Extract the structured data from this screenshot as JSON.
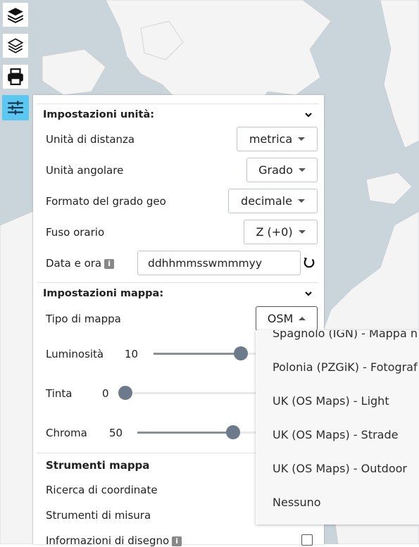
{
  "toolbar": {
    "items": [
      {
        "icon": "layers-icon",
        "active": false
      },
      {
        "icon": "layers-outline-icon",
        "active": false
      },
      {
        "icon": "print-icon",
        "active": false
      },
      {
        "icon": "sliders-icon",
        "active": true
      }
    ]
  },
  "unit_settings": {
    "title": "Impostazioni unità:",
    "distance": {
      "label": "Unità di distanza",
      "value": "metrica"
    },
    "angular": {
      "label": "Unità angolare",
      "value": "Grado"
    },
    "geo_format": {
      "label": "Formato del grado geo",
      "value": "decimale"
    },
    "timezone": {
      "label": "Fuso orario",
      "value": "Z (+0)"
    },
    "datetime": {
      "label": "Data e ora",
      "value": "ddhhmmsswmmmyy"
    }
  },
  "map_settings": {
    "title": "Impostazioni mappa:",
    "map_type": {
      "label": "Tipo di mappa",
      "value": "OSM"
    },
    "brightness": {
      "label": "Luminosità",
      "value": "10",
      "level": 0.53
    },
    "hue": {
      "label": "Tinta",
      "value": "0",
      "level": 0.0
    },
    "chroma": {
      "label": "Chroma",
      "value": "50",
      "level": 0.53
    }
  },
  "map_tools": {
    "title": "Strumenti mappa",
    "coord_search": "Ricerca di coordinate",
    "measure": "Strumenti di misura",
    "draw_info": "Informazioni di disegno"
  },
  "map_type_menu": {
    "options": [
      "Spagnolo (IGN) - Mappa n",
      "Polonia (PZGiK) - Fotograf",
      "UK (OS Maps) - Light",
      "UK (OS Maps) - Strade",
      "UK (OS Maps) - Outdoor",
      "Nessuno"
    ]
  },
  "colors": {
    "ocean": "#c9d4db",
    "land": "#f4f4f4",
    "accent": "#5bc8f2",
    "slider_thumb": "#6c7a8b"
  }
}
